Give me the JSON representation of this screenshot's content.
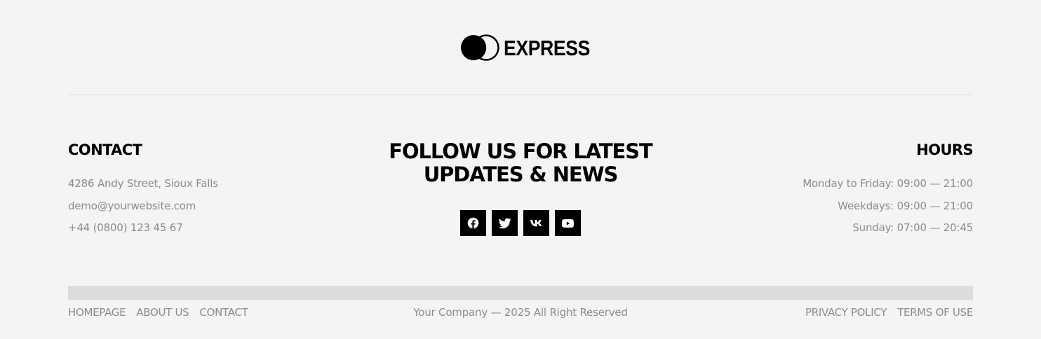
{
  "logo": {
    "text": "EXPRESS"
  },
  "contact": {
    "heading": "CONTACT",
    "address": "4286 Andy Street, Sioux Falls",
    "email": "demo@yourwebsite.com",
    "phone": "+44 (0800) 123 45 67"
  },
  "follow": {
    "title_line1": "FOLLOW US FOR LATEST",
    "title_line2": "UPDATES & NEWS",
    "social": [
      {
        "icon": "facebook-icon"
      },
      {
        "icon": "twitter-icon"
      },
      {
        "icon": "vk-icon"
      },
      {
        "icon": "youtube-icon"
      }
    ]
  },
  "hours": {
    "heading": "HOURS",
    "lines": [
      "Monday to Friday: 09:00 — 21:00",
      "Weekdays: 09:00 — 21:00",
      "Sunday: 07:00 — 20:45"
    ]
  },
  "bottom": {
    "nav_left": [
      "HOMEPAGE",
      "ABOUT US",
      "CONTACT"
    ],
    "copyright": "Your Company — 2025 All Right Reserved",
    "nav_right": [
      "PRIVACY POLICY",
      "TERMS OF USE"
    ]
  },
  "colors": {
    "background": "#f4f4f4",
    "text": "#000000",
    "muted": "#8c8c8c",
    "divider": "#dcdcdc"
  }
}
